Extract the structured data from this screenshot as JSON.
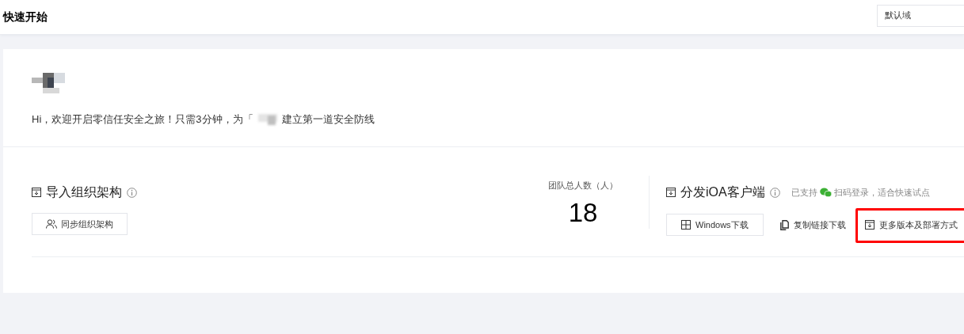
{
  "header": {
    "title": "快速开始",
    "domain_select": {
      "value": "默认域"
    }
  },
  "intro": {
    "greeting_before": "Hi，欢迎开启零信任安全之旅！只需3分钟，为「",
    "greeting_after": "建立第一道安全防线"
  },
  "org_section": {
    "title": "导入组织架构",
    "button": "同步组织架构"
  },
  "team_count": {
    "label": "团队总人数（人）",
    "value": "18"
  },
  "client_section": {
    "title": "分发iOA客户端",
    "note_before": "已支持",
    "note_after": "扫码登录，适合快速试点",
    "actions": [
      {
        "kind": "button",
        "label": "Windows下载",
        "highlighted": false
      },
      {
        "kind": "link",
        "label": "复制链接下载",
        "highlighted": false
      },
      {
        "kind": "link",
        "label": "更多版本及部署方式",
        "highlighted": true
      }
    ]
  }
}
